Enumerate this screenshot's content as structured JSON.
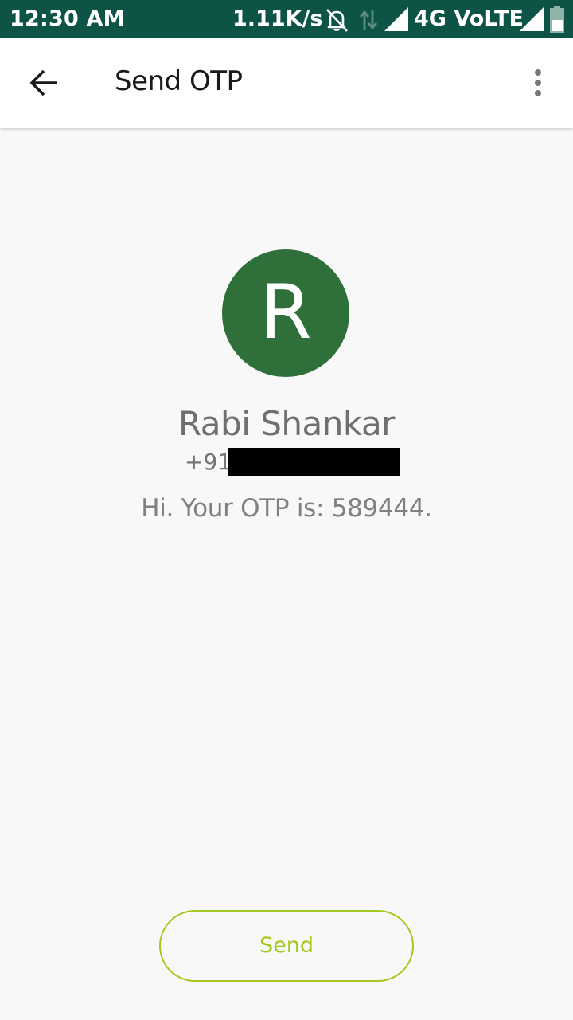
{
  "status_bar": {
    "time": "12:30 AM",
    "speed": "1.11K/s",
    "network": "4G VoLTE",
    "icons": [
      "bell-off-icon",
      "data-arrows-icon",
      "signal-icon",
      "signal-icon",
      "battery-icon"
    ]
  },
  "app_bar": {
    "title": "Send OTP",
    "back_icon": "arrow-back-icon",
    "menu_icon": "more-vert-icon"
  },
  "contact": {
    "avatar_letter": "R",
    "avatar_color": "#2e6f3a",
    "name": "Rabi Shankar",
    "phone_visible": "+91"
  },
  "message": {
    "text": "Hi. Your OTP is: 589444."
  },
  "send_button": {
    "label": "Send",
    "color": "#a5c81e"
  },
  "colors": {
    "status_bar": "#0d5446",
    "background": "#f8f8f8"
  }
}
